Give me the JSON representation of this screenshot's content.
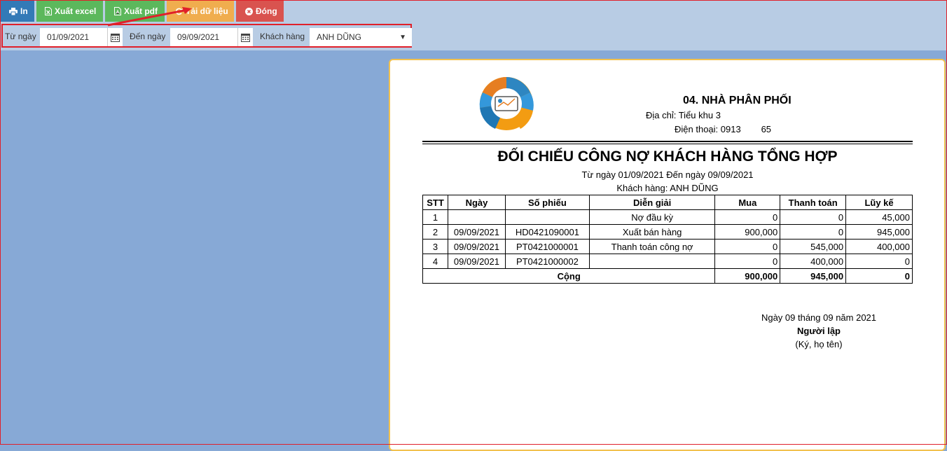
{
  "toolbar": {
    "print_label": "In",
    "excel_label": "Xuất excel",
    "pdf_label": "Xuất pdf",
    "reload_label": "Tải dữ liệu",
    "close_label": "Đóng"
  },
  "filters": {
    "from_label": "Từ ngày",
    "from_value": "01/09/2021",
    "to_label": "Đến ngày",
    "to_value": "09/09/2021",
    "customer_label": "Khách hàng",
    "customer_value": "ANH DŨNG"
  },
  "report": {
    "company": "04. NHÀ PHÂN PHỐI",
    "address": "Địa chỉ: Tiểu khu 3",
    "phone": "Điện thoại: 0913        65",
    "title": "ĐỐI CHIẾU CÔNG NỢ KHÁCH HÀNG TỔNG HỢP",
    "period": "Từ ngày 01/09/2021 Đến ngày 09/09/2021",
    "customer": "Khách hàng: ANH DŨNG",
    "columns": [
      "STT",
      "Ngày",
      "Số phiếu",
      "Diễn giải",
      "Mua",
      "Thanh toán",
      "Lũy kế"
    ],
    "rows": [
      [
        "1",
        "",
        "",
        "Nợ đầu kỳ",
        "0",
        "0",
        "45,000"
      ],
      [
        "2",
        "09/09/2021",
        "HD0421090001",
        "Xuất bán hàng",
        "900,000",
        "0",
        "945,000"
      ],
      [
        "3",
        "09/09/2021",
        "PT0421000001",
        "Thanh toán công nợ",
        "0",
        "545,000",
        "400,000"
      ],
      [
        "4",
        "09/09/2021",
        "PT0421000002",
        "",
        "0",
        "400,000",
        "0"
      ]
    ],
    "total": {
      "label": "Cộng",
      "mua": "900,000",
      "thanh_toan": "945,000",
      "luy_ke": "0"
    },
    "sign_date": "Ngày 09 tháng 09 năm 2021",
    "sign_role": "Người lập",
    "sign_note": "(Ký, họ tên)"
  },
  "colors": {
    "print": "#337ab7",
    "excel": "#5cb85c",
    "reload": "#f0ad4e",
    "close": "#d9534f",
    "highlight": "#e0202a"
  }
}
